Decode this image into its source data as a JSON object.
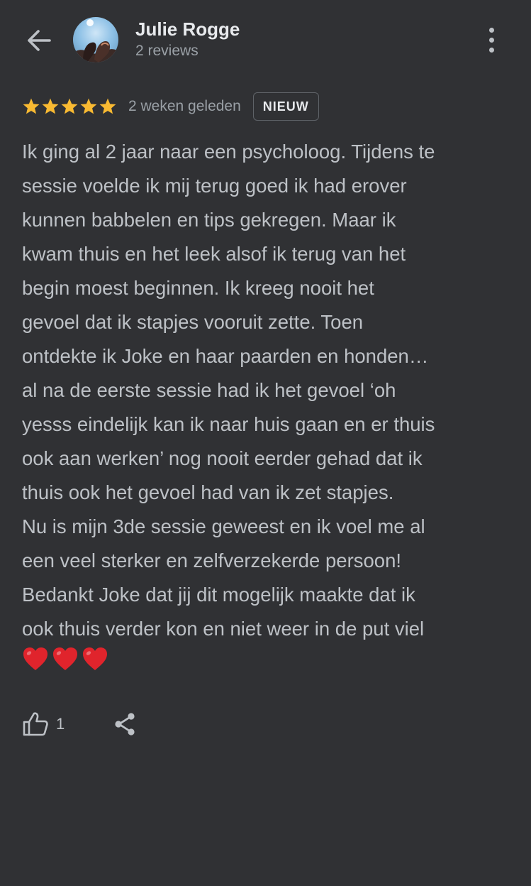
{
  "header": {
    "reviewer_name": "Julie Rogge",
    "review_count": "2 reviews",
    "back_icon": "arrow-back-icon",
    "menu_icon": "more-vert-icon"
  },
  "review": {
    "rating": 5,
    "max_rating": 5,
    "time_ago": "2 weken geleden",
    "badge": "NIEUW",
    "text_paragraph_1": "Ik ging al 2 jaar naar een psycholoog. Tijdens te\nsessie voelde ik mij terug goed ik had erover\nkunnen babbelen en tips gekregen. Maar ik\nkwam thuis en het leek alsof ik terug van het\nbegin moest beginnen. Ik kreeg nooit het\ngevoel dat ik stapjes vooruit zette. Toen\nontdekte ik Joke en haar paarden en honden…\nal na de eerste sessie had ik het gevoel ‘oh\nyesss eindelijk kan ik naar huis gaan en er thuis\nook aan werken’ nog nooit eerder gehad dat ik\nthuis ook het gevoel had van ik zet stapjes.",
    "text_paragraph_2": "Nu is mijn 3de sessie geweest en ik voel me al\neen veel sterker en zelfverzekerde persoon!\nBedankt Joke dat jij dit mogelijk maakte dat ik\nook thuis verder kon en niet weer in de put viel",
    "hearts_emoji": "❤️❤️❤️"
  },
  "actions": {
    "like_count": "1",
    "like_icon": "thumbs-up-icon",
    "share_icon": "share-icon"
  },
  "colors": {
    "background": "#303134",
    "text": "#bdc1c6",
    "star": "#f9ba32",
    "heart": "#e0242c"
  }
}
